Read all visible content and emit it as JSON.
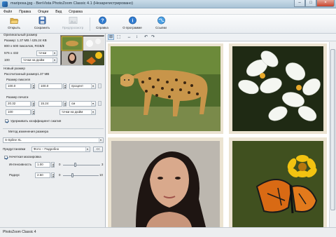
{
  "window": {
    "title": "mariposa.jpg - BenVista PhotoZoom Classic 4.1 (Незарегистрировано)"
  },
  "menu": [
    "Файл",
    "Правка",
    "Опции",
    "Вид",
    "Справка"
  ],
  "toolbar": {
    "open": "Открыть",
    "save": "Сохранить",
    "preview": "Предпросмотр",
    "help": "Справка",
    "about": "О программе",
    "links": "Ссылки"
  },
  "original": {
    "header": "Оригинальный размер",
    "size_line": "Размер: 1.37 MB / 425.24 KB",
    "dims_line": "800 x 600 пикселов, RGB/8",
    "print_size": "576 x 432",
    "print_unit": "точки",
    "dpi": "100",
    "dpi_unit": "точки на дюйм"
  },
  "new_size": {
    "header": "Новый размер",
    "calc_size": "Рассчитанный размер1.37 MB",
    "pixel_group": "Размер пикселя",
    "width_val": "100.0",
    "height_val": "100.0",
    "pixel_unit": "процент",
    "print_group": "Размер печати",
    "print_w": "20.32",
    "print_h": "15.24",
    "print_unit": "см",
    "res_val": "100",
    "res_unit": "точки на дюйм",
    "keep_ratio": "Удерживать коэффициент сжатия"
  },
  "method": {
    "header": "Метод изменения размера",
    "algorithm": "S-Spline XL",
    "preset_label": "Предустановки",
    "preset_value": "Фото – Подробно",
    "preset_btn": "<<",
    "unsharp_label": "Нечеткая маскировка",
    "intensity_label": "Интенсивность",
    "intensity_val": "1.00",
    "intensity_min": "0",
    "intensity_max": "3",
    "radius_label": "Радиус",
    "radius_val": "2.50",
    "radius_min": "0",
    "radius_max": "10"
  },
  "status": {
    "text": "PhotoZoom Classic 4"
  },
  "icons": [
    "folder-open-icon",
    "disk-save-icon",
    "preview-icon",
    "help-icon",
    "info-icon",
    "globe-links-icon"
  ],
  "colors": {
    "accent": "#1f6fc8",
    "title_bar": "#b6cddd"
  }
}
